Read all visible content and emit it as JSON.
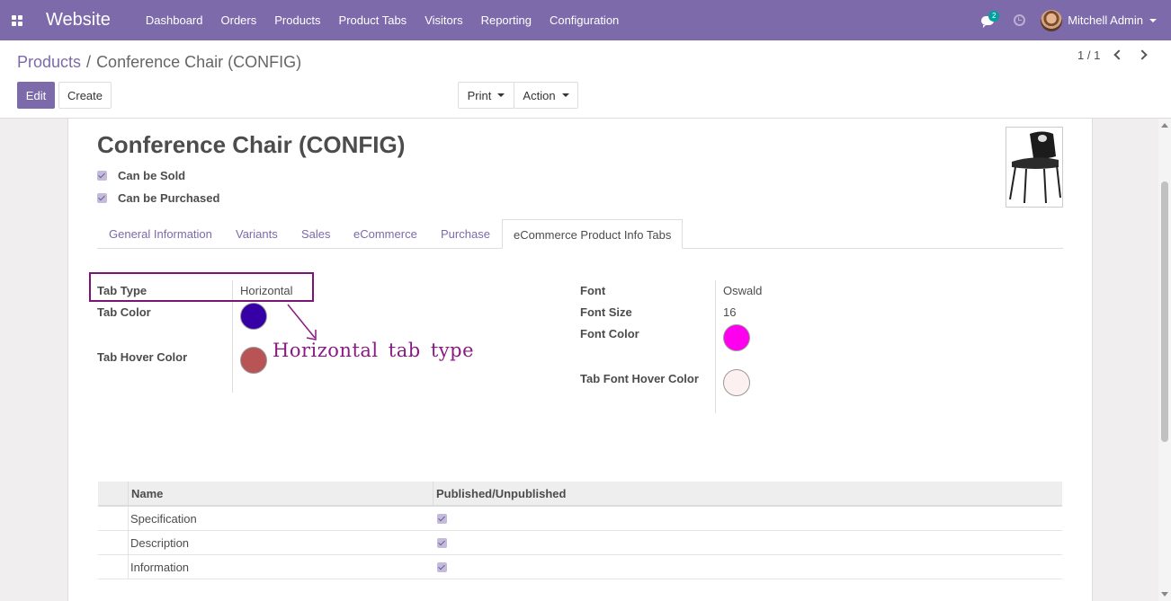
{
  "navbar": {
    "app_title": "Website",
    "menu": [
      "Dashboard",
      "Orders",
      "Products",
      "Product Tabs",
      "Visitors",
      "Reporting",
      "Configuration"
    ],
    "chat_count": "2",
    "user_name": "Mitchell Admin"
  },
  "breadcrumb": {
    "parent": "Products",
    "separator": "/",
    "current": "Conference Chair (CONFIG)"
  },
  "toolbar": {
    "edit_label": "Edit",
    "create_label": "Create",
    "print_label": "Print",
    "action_label": "Action",
    "pager": "1 / 1"
  },
  "product": {
    "name": "Conference Chair (CONFIG)",
    "can_be_sold_label": "Can be Sold",
    "can_be_sold": true,
    "can_be_purchased_label": "Can be Purchased",
    "can_be_purchased": true
  },
  "tabs": [
    {
      "label": "General Information",
      "active": false
    },
    {
      "label": "Variants",
      "active": false
    },
    {
      "label": "Sales",
      "active": false
    },
    {
      "label": "eCommerce",
      "active": false
    },
    {
      "label": "Purchase",
      "active": false
    },
    {
      "label": "eCommerce Product Info Tabs",
      "active": true
    }
  ],
  "fields_left": {
    "tab_type_label": "Tab Type",
    "tab_type_value": "Horizontal",
    "tab_color_label": "Tab Color",
    "tab_color": "#3700a6",
    "tab_hover_color_label": "Tab Hover Color",
    "tab_hover_color": "#b85456"
  },
  "fields_right": {
    "font_label": "Font",
    "font_value": "Oswald",
    "font_size_label": "Font Size",
    "font_size_value": "16",
    "font_color_label": "Font Color",
    "font_color": "#ff00ee",
    "tab_font_hover_color_label": "Tab Font Hover Color",
    "tab_font_hover_color": "#fcf0f0"
  },
  "annotation": {
    "text": "Horizontal tab type",
    "color": "#8a1a83"
  },
  "table": {
    "headers": [
      "Name",
      "Published/Unpublished"
    ],
    "rows": [
      {
        "name": "Specification",
        "published": true
      },
      {
        "name": "Description",
        "published": true
      },
      {
        "name": "Information",
        "published": true
      }
    ]
  }
}
